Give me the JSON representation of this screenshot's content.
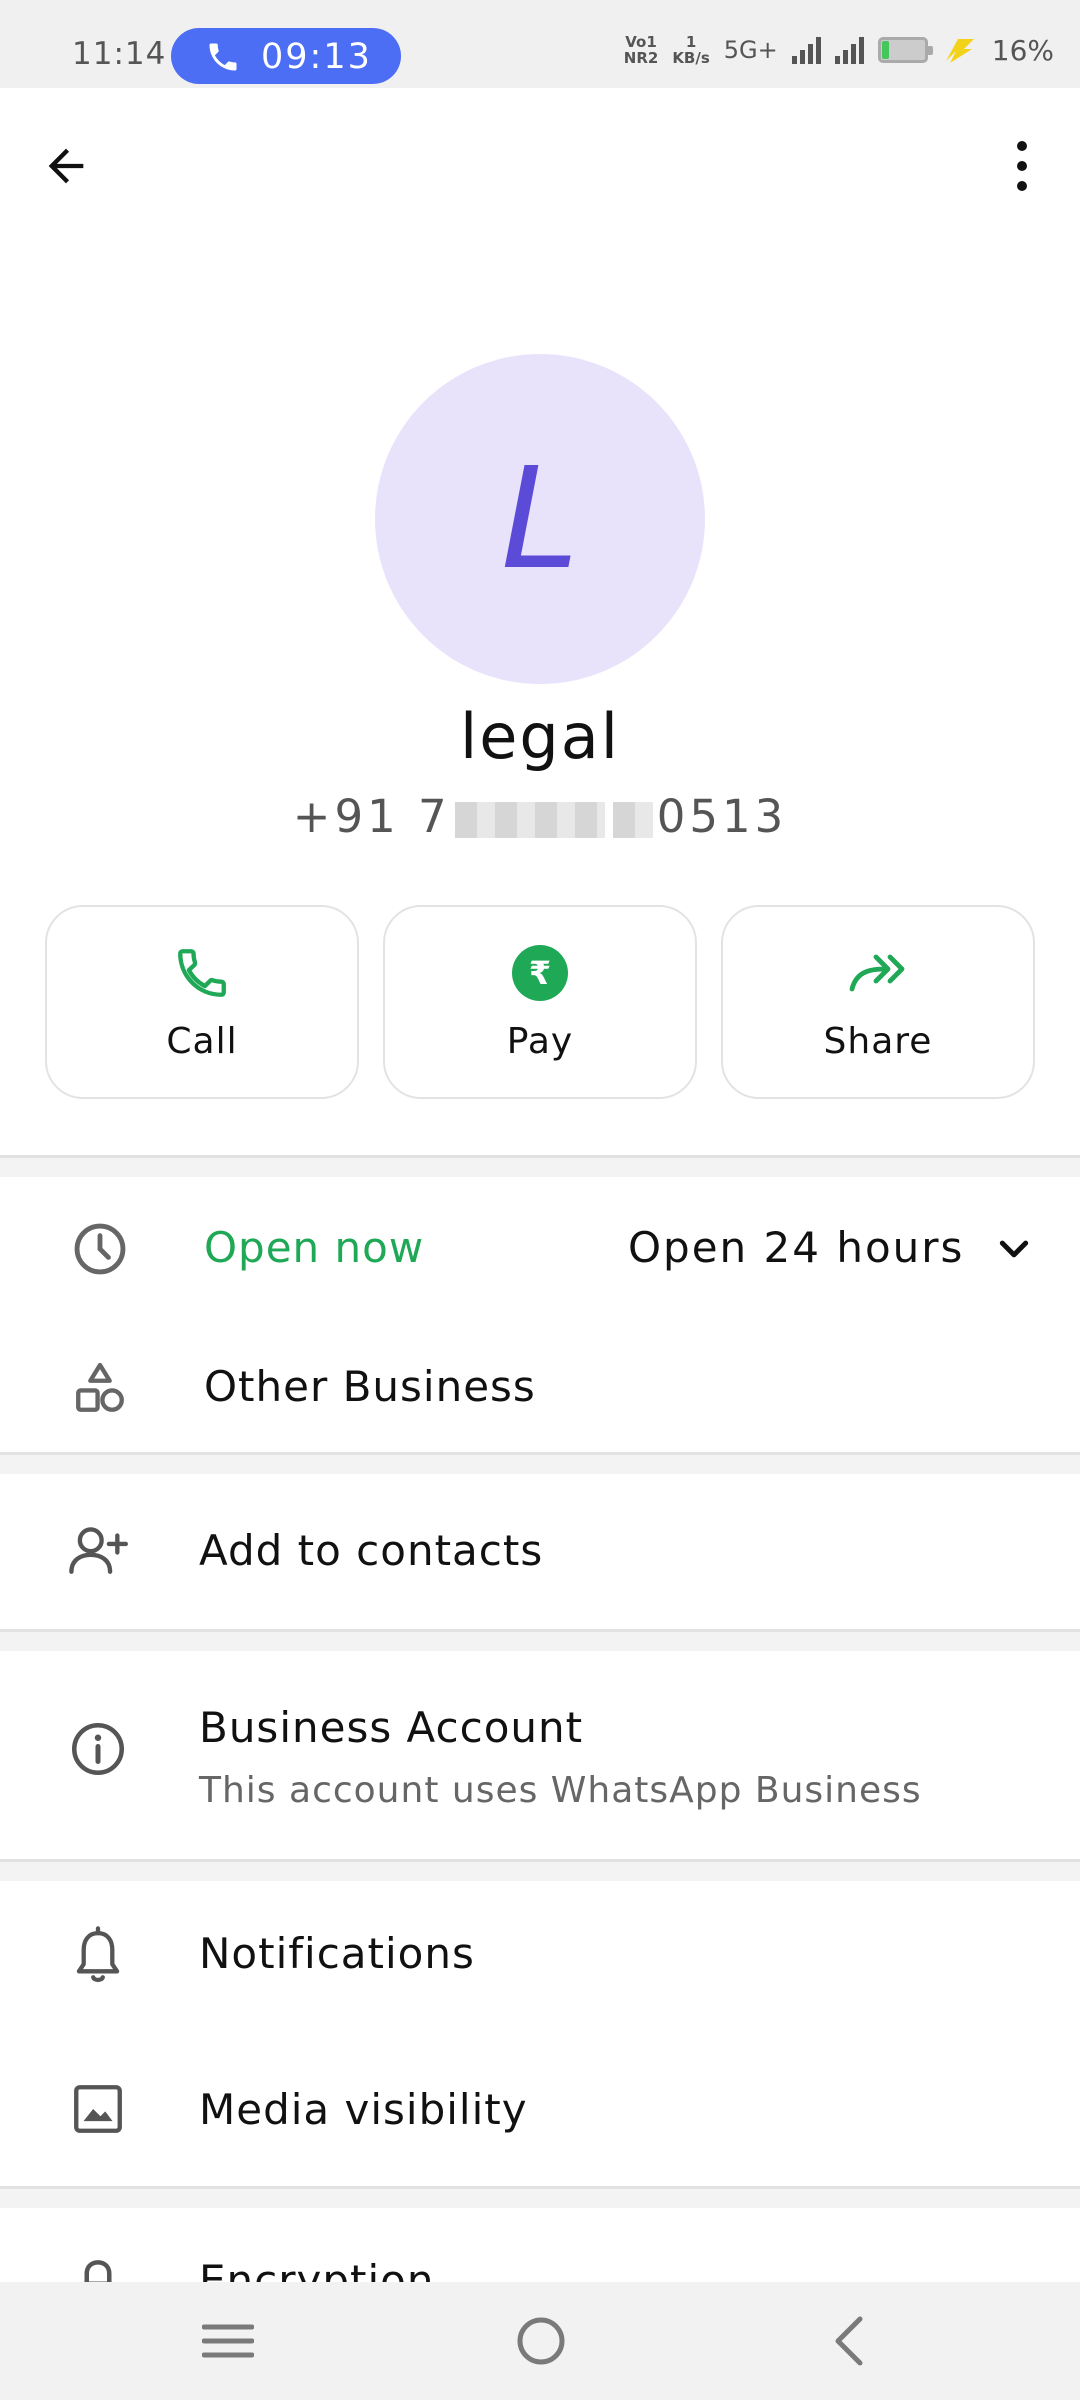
{
  "status_bar": {
    "time": "11:14",
    "call_timer": "09:13",
    "volte_top": "Vo1",
    "volte_bottom": "NR2",
    "speed_top": "1",
    "speed_bottom": "KB/s",
    "network": "5G+",
    "battery_percent": "16%",
    "battery_level": 0.16
  },
  "app_bar": {
    "back_icon": "arrow-back-icon",
    "menu_icon": "more-vert-icon"
  },
  "contact": {
    "avatar_initial": "L",
    "avatar_color": "#e8e3fb",
    "initial_color": "#5b4bd6",
    "name": "legal",
    "phone_prefix": "+91 7",
    "phone_suffix": "0513"
  },
  "actions": [
    {
      "label": "Call",
      "icon": "phone-icon"
    },
    {
      "label": "Pay",
      "icon": "rupee-icon"
    },
    {
      "label": "Share",
      "icon": "share-forward-icon"
    }
  ],
  "business_hours": {
    "status": "Open now",
    "hours": "Open 24 hours",
    "status_color": "#1fa855"
  },
  "category": {
    "label": "Other Business"
  },
  "add_contact": {
    "label": "Add to contacts"
  },
  "business_account": {
    "title": "Business Account",
    "subtitle": "This account uses WhatsApp Business"
  },
  "notifications": {
    "label": "Notifications"
  },
  "media_visibility": {
    "label": "Media visibility"
  },
  "encryption": {
    "label": "Encryption"
  },
  "accent_color": "#1fa855"
}
